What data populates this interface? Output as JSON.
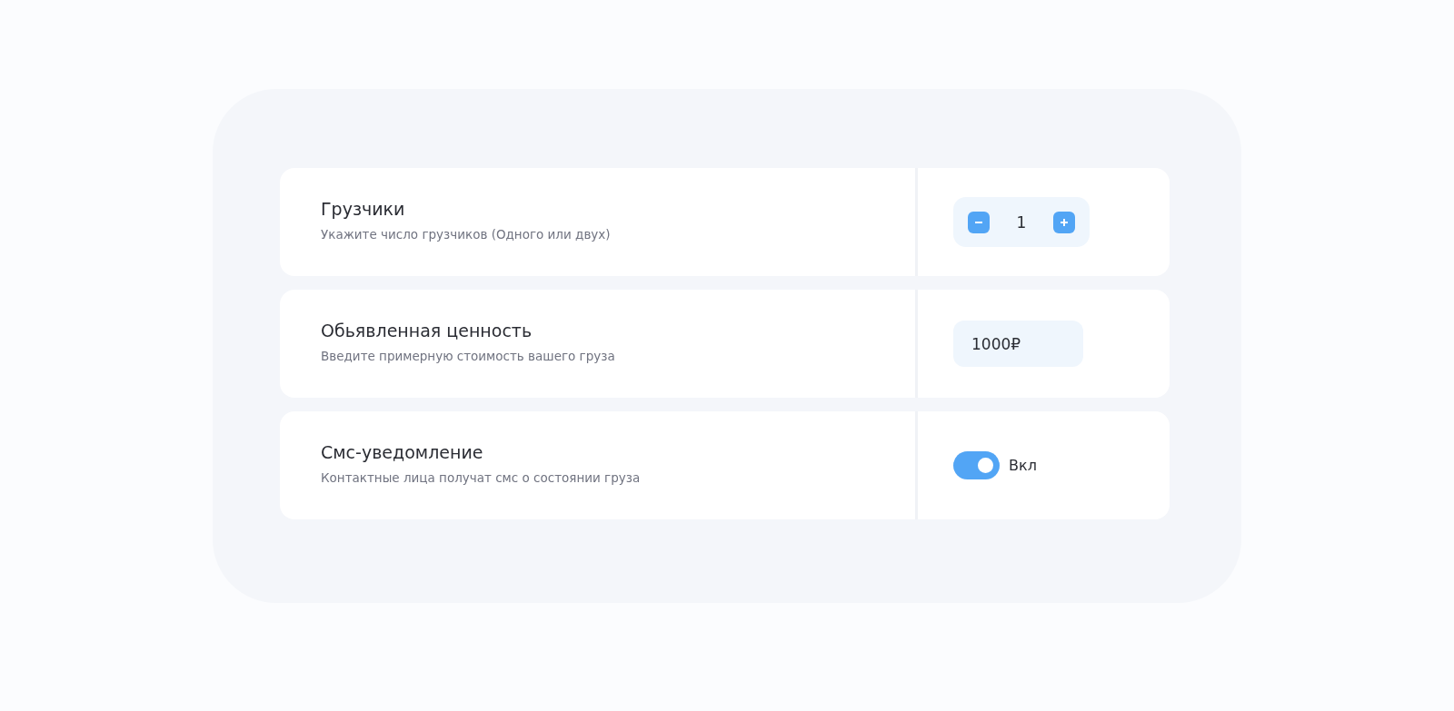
{
  "options": [
    {
      "kind": "stepper",
      "title": "Грузчики",
      "description": "Укажите число грузчиков (Одного или двух)",
      "value": "1"
    },
    {
      "kind": "input",
      "title": "Обьявленная ценность",
      "description": "Введите примерную стоимость вашего груза",
      "value": "1000₽"
    },
    {
      "kind": "toggle",
      "title": "Смс-уведомление",
      "description": "Контактные лица получат смс о состоянии груза",
      "on": true,
      "label": "Вкл"
    }
  ]
}
